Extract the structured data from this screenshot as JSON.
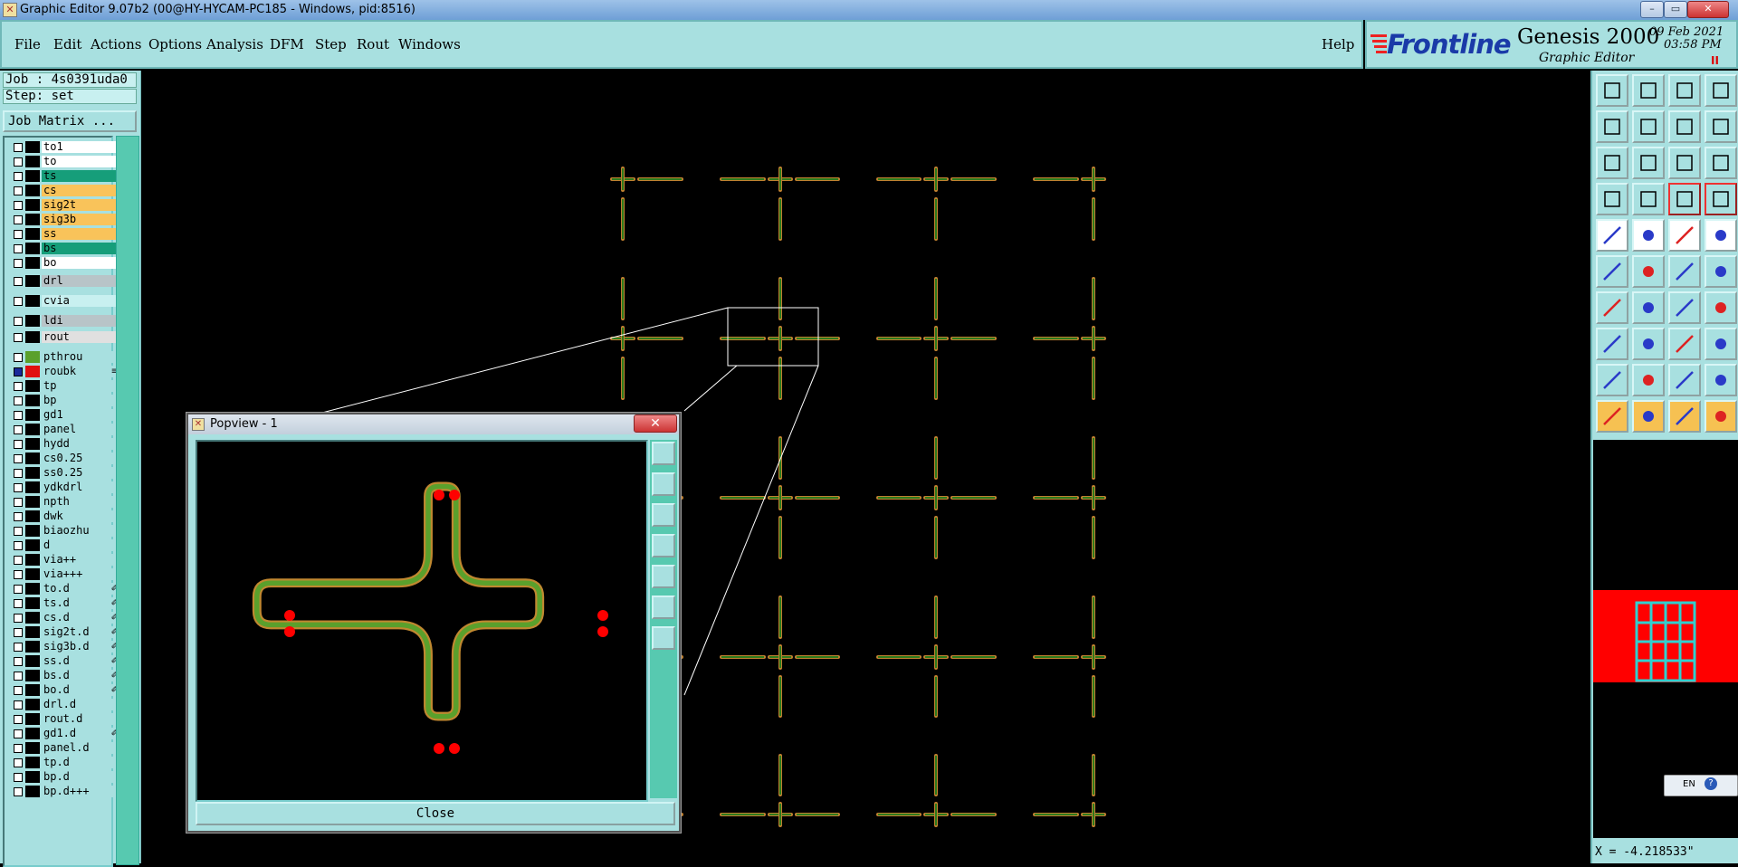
{
  "window": {
    "title": "Graphic Editor 9.07b2 (00@HY-HYCAM-PC185 - Windows, pid:8516)",
    "minimize": "–",
    "maximize": "▭",
    "close": "✕"
  },
  "menu": {
    "items": [
      "File",
      "Edit",
      "Actions",
      "Options",
      "Analysis",
      "DFM",
      "Step",
      "Rout",
      "Windows"
    ],
    "help": "Help"
  },
  "brand": {
    "logo": "Frontline",
    "product": "Genesis 2000",
    "subtitle": "Graphic Editor",
    "date": "09 Feb 2021",
    "time": "03:58 PM",
    "pause_mark": "II"
  },
  "left": {
    "job": "Job : 4s0391uda0",
    "step": "Step: set",
    "job_matrix": "Job Matrix ..."
  },
  "layers": [
    {
      "name": "to1",
      "color": "#ffffff",
      "swatch": "#000000",
      "mark": ""
    },
    {
      "name": "to",
      "color": "#ffffff",
      "swatch": "#000000",
      "mark": ""
    },
    {
      "name": "ts",
      "color": "#169e7a",
      "swatch": "#000000",
      "mark": ""
    },
    {
      "name": "cs",
      "color": "#f9c35a",
      "swatch": "#000000",
      "mark": ""
    },
    {
      "name": "sig2t",
      "color": "#f9c35a",
      "swatch": "#000000",
      "mark": ""
    },
    {
      "name": "sig3b",
      "color": "#f9c35a",
      "swatch": "#000000",
      "mark": ""
    },
    {
      "name": "ss",
      "color": "#f9c35a",
      "swatch": "#000000",
      "mark": ""
    },
    {
      "name": "bs",
      "color": "#169e7a",
      "swatch": "#000000",
      "mark": ""
    },
    {
      "name": "bo",
      "color": "#ffffff",
      "swatch": "#000000",
      "mark": ""
    },
    {
      "name": "drl",
      "color": "#b8c4c8",
      "swatch": "#000000",
      "mark": ""
    },
    {
      "name": "cvia",
      "color": "#c8f0f0",
      "swatch": "#000000",
      "mark": ""
    },
    {
      "name": "ldi",
      "color": "#b8c4c8",
      "swatch": "#000000",
      "mark": ""
    },
    {
      "name": "rout",
      "color": "#e0e0e0",
      "swatch": "#000000",
      "mark": ""
    },
    {
      "name": "pthrou",
      "color": "#a8e0e0",
      "swatch": "#5aa02c",
      "mark": ""
    },
    {
      "name": "roubk",
      "color": "#a8e0e0",
      "swatch": "#e01010",
      "mark": "≡",
      "cb": "#1a2a9a"
    },
    {
      "name": "tp",
      "color": "#a8e0e0",
      "swatch": "#000000",
      "mark": ""
    },
    {
      "name": "bp",
      "color": "#a8e0e0",
      "swatch": "#000000",
      "mark": ""
    },
    {
      "name": "gd1",
      "color": "#a8e0e0",
      "swatch": "#000000",
      "mark": ""
    },
    {
      "name": "panel",
      "color": "#a8e0e0",
      "swatch": "#000000",
      "mark": ""
    },
    {
      "name": "hydd",
      "color": "#a8e0e0",
      "swatch": "#000000",
      "mark": ""
    },
    {
      "name": "cs0.25",
      "color": "#a8e0e0",
      "swatch": "#000000",
      "mark": ""
    },
    {
      "name": "ss0.25",
      "color": "#a8e0e0",
      "swatch": "#000000",
      "mark": ""
    },
    {
      "name": "ydkdrl",
      "color": "#a8e0e0",
      "swatch": "#000000",
      "mark": ""
    },
    {
      "name": "npth",
      "color": "#a8e0e0",
      "swatch": "#000000",
      "mark": ""
    },
    {
      "name": "dwk",
      "color": "#a8e0e0",
      "swatch": "#000000",
      "mark": ""
    },
    {
      "name": "biaozhu",
      "color": "#a8e0e0",
      "swatch": "#000000",
      "mark": ""
    },
    {
      "name": "d",
      "color": "#a8e0e0",
      "swatch": "#000000",
      "mark": ""
    },
    {
      "name": "via++",
      "color": "#a8e0e0",
      "swatch": "#000000",
      "mark": ""
    },
    {
      "name": "via+++",
      "color": "#a8e0e0",
      "swatch": "#000000",
      "mark": ""
    },
    {
      "name": "to.d",
      "color": "#a8e0e0",
      "swatch": "#000000",
      "mark": "✐"
    },
    {
      "name": "ts.d",
      "color": "#a8e0e0",
      "swatch": "#000000",
      "mark": "✐"
    },
    {
      "name": "cs.d",
      "color": "#a8e0e0",
      "swatch": "#000000",
      "mark": "✐"
    },
    {
      "name": "sig2t.d",
      "color": "#a8e0e0",
      "swatch": "#000000",
      "mark": "✐"
    },
    {
      "name": "sig3b.d",
      "color": "#a8e0e0",
      "swatch": "#000000",
      "mark": "✐"
    },
    {
      "name": "ss.d",
      "color": "#a8e0e0",
      "swatch": "#000000",
      "mark": "✐"
    },
    {
      "name": "bs.d",
      "color": "#a8e0e0",
      "swatch": "#000000",
      "mark": "✐"
    },
    {
      "name": "bo.d",
      "color": "#a8e0e0",
      "swatch": "#000000",
      "mark": "✐"
    },
    {
      "name": "drl.d",
      "color": "#a8e0e0",
      "swatch": "#000000",
      "mark": ""
    },
    {
      "name": "rout.d",
      "color": "#a8e0e0",
      "swatch": "#000000",
      "mark": ""
    },
    {
      "name": "gd1.d",
      "color": "#a8e0e0",
      "swatch": "#000000",
      "mark": "✐"
    },
    {
      "name": "panel.d",
      "color": "#a8e0e0",
      "swatch": "#000000",
      "mark": ""
    },
    {
      "name": "tp.d",
      "color": "#a8e0e0",
      "swatch": "#000000",
      "mark": ""
    },
    {
      "name": "bp.d",
      "color": "#a8e0e0",
      "swatch": "#000000",
      "mark": ""
    },
    {
      "name": "bp.d+++",
      "color": "#a8e0e0",
      "swatch": "#000000",
      "mark": ""
    }
  ],
  "popview": {
    "title": "Popview - 1",
    "close_x": "✕",
    "close_button": "Close"
  },
  "toolbar_icons": [
    "open-job-icon",
    "save-icon",
    "home-icon",
    "window-split-icon",
    "step-in-icon",
    "step-out-icon",
    "undo-icon",
    "snake-icon",
    "zoom-fit-icon",
    "zoom-center-icon",
    "scale-1to2-icon",
    "help-query-icon",
    "measure-icon",
    "pad-icon",
    "layer-up-icon",
    "layer-down-icon",
    "add-pad-icon",
    "line-red-icon",
    "ruler-icon",
    "circle-pad-icon",
    "node-connect-icon",
    "cross-node-icon",
    "point-a-icon",
    "point-b-icon",
    "slope-line-icon",
    "diagonal-line-icon",
    "rotate-icon",
    "split-line-icon",
    "corner-pad-icon",
    "horizontal-line-icon",
    "bracket-icon",
    "square-pad-icon",
    "triangle-a-icon",
    "triangle-b-icon",
    "arch-icon",
    "arch-b-icon",
    "select-arrow-icon",
    "select-arrow-red-icon",
    "select-arrow-b-icon",
    "route-icon"
  ],
  "status": {
    "coordinate": "X = -4.218533\"",
    "lang": "EN"
  }
}
